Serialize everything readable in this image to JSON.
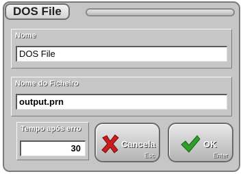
{
  "dialog": {
    "title": "DOS File"
  },
  "fields": {
    "name": {
      "label": "Nome",
      "value": "DOS File"
    },
    "filename": {
      "label": "Nome do Ficheiro",
      "value": "output.prn"
    },
    "timeout": {
      "label": "Tempo após erro",
      "value": "30"
    }
  },
  "buttons": {
    "cancel": {
      "label": "Cancela",
      "shortcut": "Esc",
      "icon": "x-mark-icon",
      "color": "#c81e1e"
    },
    "ok": {
      "label": "OK",
      "shortcut": "Enter",
      "icon": "checkmark-icon",
      "color": "#2ea02a"
    }
  }
}
